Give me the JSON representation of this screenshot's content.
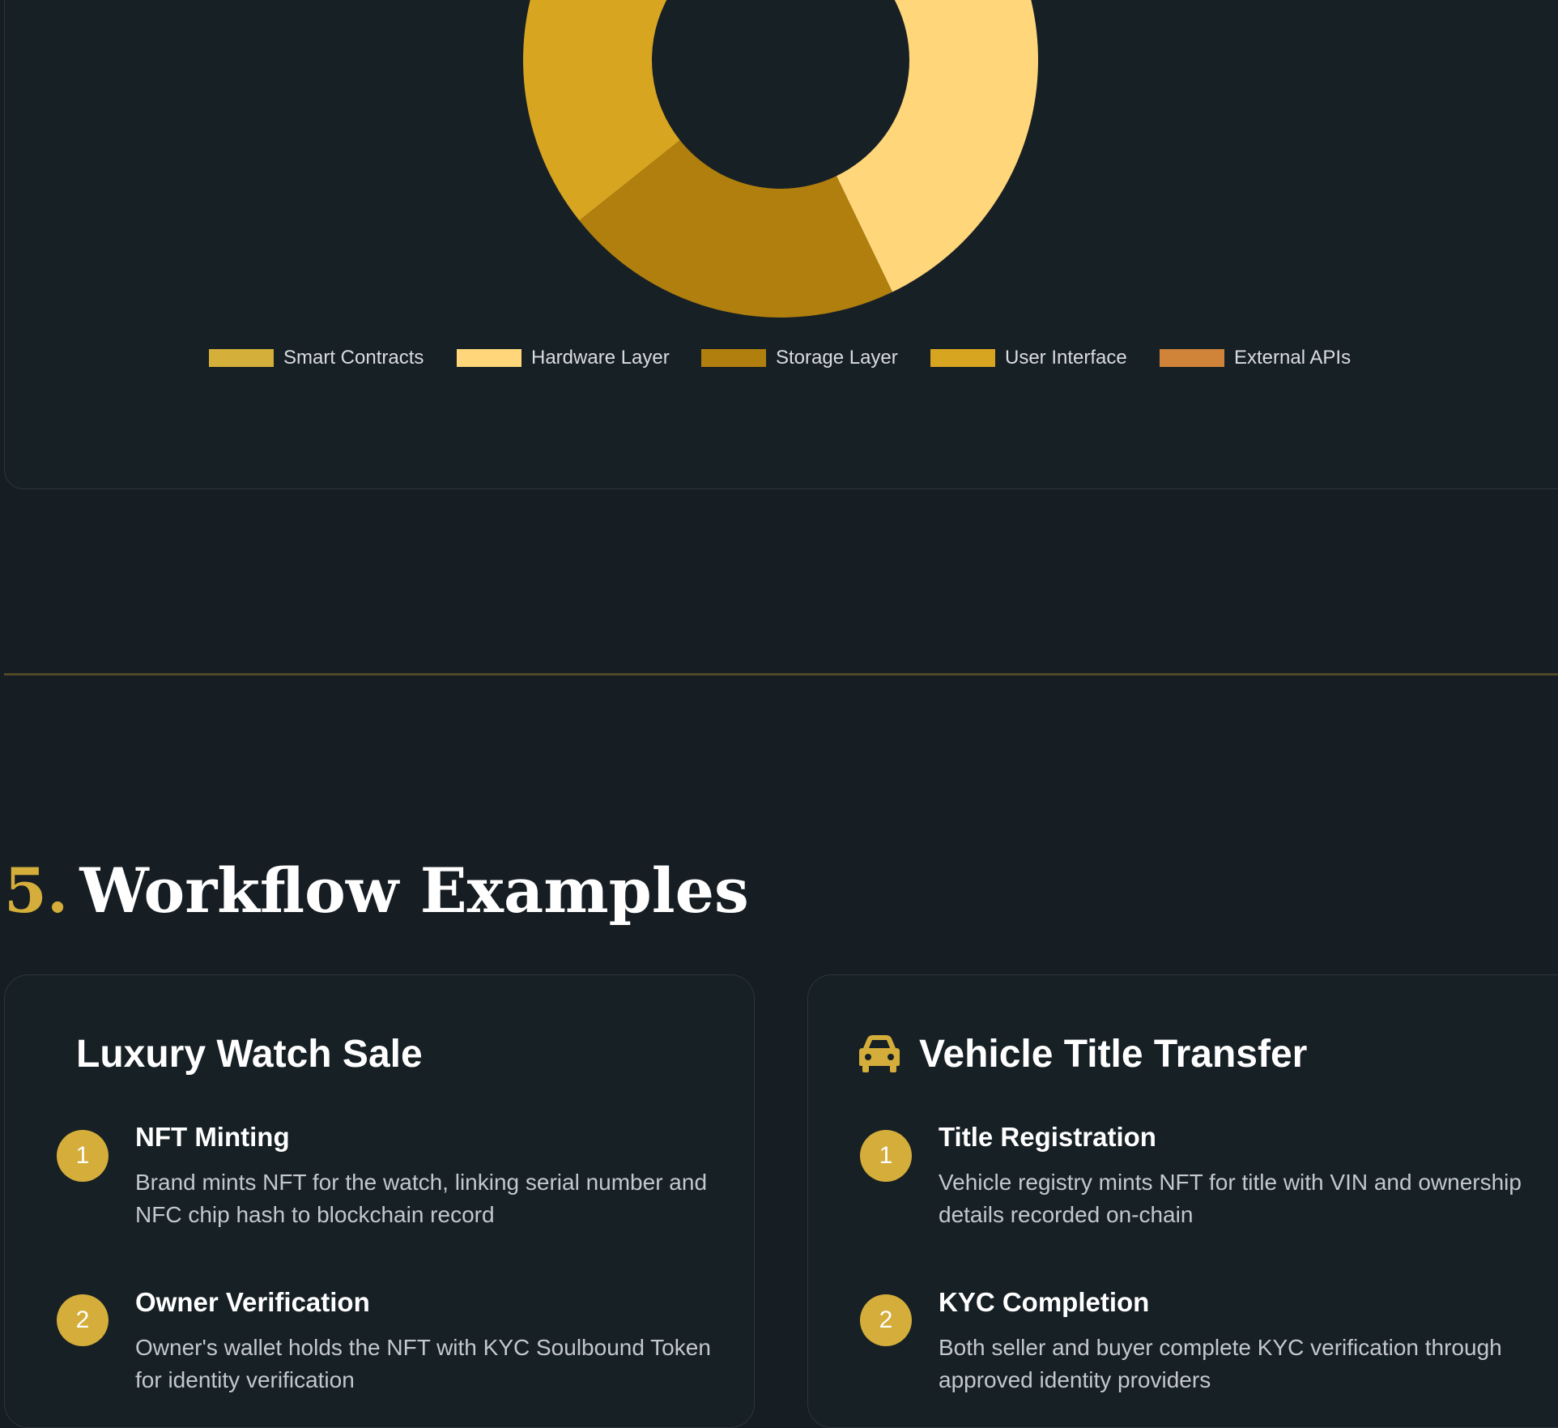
{
  "chart_data": {
    "type": "pie",
    "variant": "donut",
    "categories": [
      "Smart Contracts",
      "Hardware Layer",
      "Storage Layer",
      "User Interface",
      "External APIs"
    ],
    "values": [
      10,
      20,
      15,
      25,
      0
    ],
    "colors": [
      "#d4b03a",
      "#ffd67a",
      "#b07f0d",
      "#d8a521",
      "#cf843a"
    ],
    "legend_position": "bottom",
    "title": ""
  },
  "section": {
    "number": "5.",
    "title": "Workflow Examples"
  },
  "workflows": [
    {
      "title": "Luxury Watch Sale",
      "icon": "",
      "steps": [
        {
          "num": "1",
          "title": "NFT Minting",
          "desc": "Brand mints NFT for the watch, linking serial number and NFC chip hash to blockchain record"
        },
        {
          "num": "2",
          "title": "Owner Verification",
          "desc": "Owner's wallet holds the NFT with KYC Soulbound Token for identity verification"
        }
      ]
    },
    {
      "title": "Vehicle Title Transfer",
      "icon": "car-icon",
      "steps": [
        {
          "num": "1",
          "title": "Title Registration",
          "desc": "Vehicle registry mints NFT for title with VIN and ownership details recorded on-chain"
        },
        {
          "num": "2",
          "title": "KYC Completion",
          "desc": "Both seller and buyer complete KYC verification through approved identity providers"
        }
      ]
    }
  ],
  "colors": {
    "background": "#161e23",
    "card": "#172025",
    "accent": "#d4ad3a"
  }
}
